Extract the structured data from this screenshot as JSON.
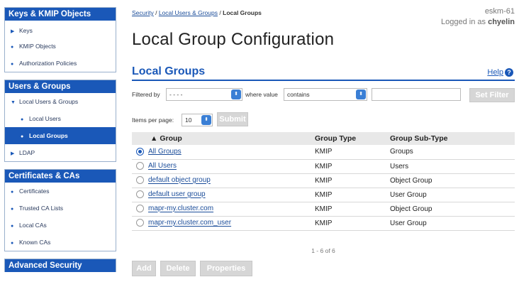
{
  "sidebar": {
    "sections": [
      {
        "title": "Keys & KMIP Objects",
        "items": [
          {
            "label": "Keys",
            "marker": "▶"
          },
          {
            "label": "KMIP Objects",
            "marker": "●"
          },
          {
            "label": "Authorization Policies",
            "marker": "●"
          }
        ]
      },
      {
        "title": "Users & Groups",
        "items": [
          {
            "label": "Local Users & Groups",
            "marker": "▼"
          },
          {
            "label": "Local Users",
            "marker": "●"
          },
          {
            "label": "Local Groups",
            "marker": "●"
          },
          {
            "label": "LDAP",
            "marker": "▶"
          }
        ]
      },
      {
        "title": "Certificates & CAs",
        "items": [
          {
            "label": "Certificates",
            "marker": "●"
          },
          {
            "label": "Trusted CA Lists",
            "marker": "●"
          },
          {
            "label": "Local CAs",
            "marker": "●"
          },
          {
            "label": "Known CAs",
            "marker": "●"
          }
        ]
      },
      {
        "title": "Advanced Security",
        "items": []
      }
    ]
  },
  "breadcrumb": {
    "security": "Security",
    "sep": "/",
    "local_users_groups": "Local Users & Groups",
    "current": "Local Groups"
  },
  "header": {
    "hostname": "eskm-61",
    "logged_in_prefix": "Logged in as",
    "username": "chyelin"
  },
  "page_title": "Local Group Configuration",
  "section": {
    "title": "Local Groups",
    "help_label": "Help",
    "help_icon": "?"
  },
  "filter": {
    "filtered_by_label": "Filtered by",
    "filtered_by_value": "- - - -",
    "where_value_label": "where value",
    "condition_value": "contains",
    "text_value": "",
    "set_filter_label": "Set Filter"
  },
  "paging": {
    "items_per_page_label": "Items per page:",
    "items_per_page_value": "10",
    "submit_label": "Submit",
    "summary": "1 - 6 of 6"
  },
  "table": {
    "sort_indicator": "▲",
    "headers": {
      "group": "Group",
      "group_type": "Group Type",
      "group_sub_type": "Group Sub-Type"
    },
    "rows": [
      {
        "group": "All Groups",
        "type": "KMIP",
        "sub_type": "Groups",
        "selected": true
      },
      {
        "group": "All Users",
        "type": "KMIP",
        "sub_type": "Users",
        "selected": false
      },
      {
        "group": "default object group",
        "type": "KMIP",
        "sub_type": "Object Group",
        "selected": false
      },
      {
        "group": "default user group",
        "type": "KMIP",
        "sub_type": "User Group",
        "selected": false
      },
      {
        "group": "mapr-my.cluster.com",
        "type": "KMIP",
        "sub_type": "Object Group",
        "selected": false
      },
      {
        "group": "mapr-my.cluster.com_user",
        "type": "KMIP",
        "sub_type": "User Group",
        "selected": false
      }
    ]
  },
  "actions": {
    "add": "Add",
    "delete": "Delete",
    "properties": "Properties"
  },
  "colors": {
    "accent": "#1a58b8",
    "link": "#1a4c99",
    "disabled_button": "#d6d6d6"
  }
}
